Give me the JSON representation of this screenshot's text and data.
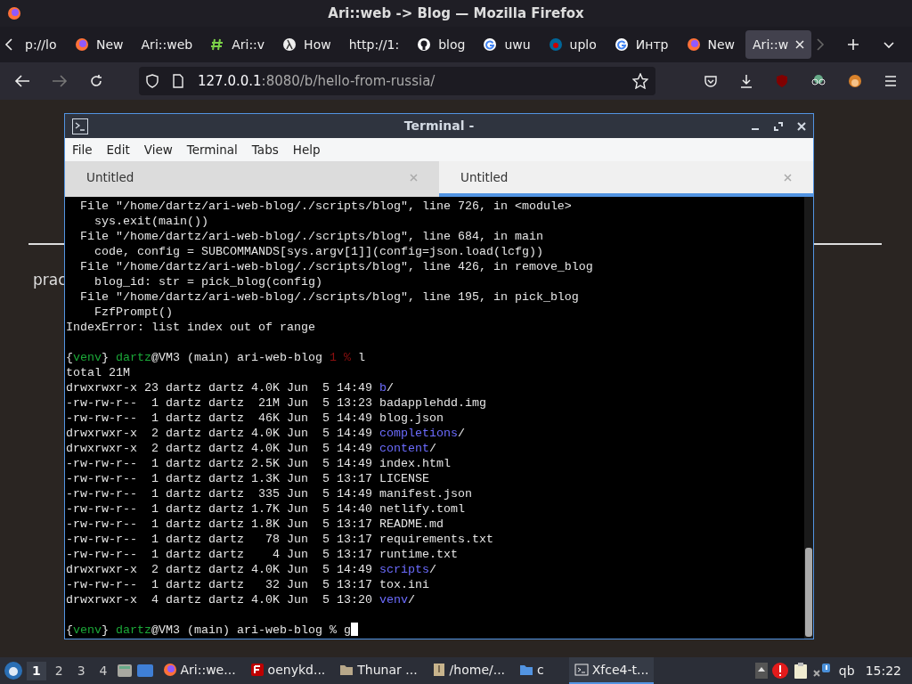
{
  "window": {
    "title": "Ari::web -> Blog — Mozilla Firefox"
  },
  "tabs": [
    {
      "label": "p://lo",
      "kind": "plain",
      "selected": false
    },
    {
      "label": "New",
      "kind": "firefox",
      "selected": false
    },
    {
      "label": "Ari::web",
      "kind": "plain",
      "selected": false
    },
    {
      "label": "Ari::v",
      "kind": "hash",
      "selected": false
    },
    {
      "label": "How",
      "kind": "lambda",
      "selected": false
    },
    {
      "label": "http://1:",
      "kind": "plain",
      "selected": false
    },
    {
      "label": "blog",
      "kind": "github",
      "selected": false
    },
    {
      "label": "uwu",
      "kind": "google",
      "selected": false
    },
    {
      "label": "uplo",
      "kind": "wiki",
      "selected": false
    },
    {
      "label": "Интр",
      "kind": "google",
      "selected": false
    },
    {
      "label": "New",
      "kind": "firefox",
      "selected": false
    },
    {
      "label": "Ari::w",
      "kind": "plain",
      "selected": true
    }
  ],
  "url": {
    "host": "127.0.0.1",
    "rest": ":8080/b/hello-from-russia/"
  },
  "page": {
    "text": "prac"
  },
  "terminal": {
    "title": "Terminal -",
    "menu": [
      "File",
      "Edit",
      "View",
      "Terminal",
      "Tabs",
      "Help"
    ],
    "tabs": [
      {
        "label": "Untitled",
        "selected": false
      },
      {
        "label": "Untitled",
        "selected": true
      }
    ],
    "blocks": [
      {
        "lines": [
          {
            "segments": [
              {
                "text": "  File \"/home/dartz/ari-web-blog/./scripts/blog\", line 726, in <module>"
              }
            ]
          },
          {
            "segments": [
              {
                "text": "    sys.exit(main())"
              }
            ]
          },
          {
            "segments": [
              {
                "text": "  File \"/home/dartz/ari-web-blog/./scripts/blog\", line 684, in main"
              }
            ]
          },
          {
            "segments": [
              {
                "text": "    code, config = SUBCOMMANDS[sys.argv[1]](config=json.load(lcfg))"
              }
            ]
          },
          {
            "segments": [
              {
                "text": "  File \"/home/dartz/ari-web-blog/./scripts/blog\", line 426, in remove_blog"
              }
            ]
          },
          {
            "segments": [
              {
                "text": "    blog_id: str = pick_blog(config)"
              }
            ]
          },
          {
            "segments": [
              {
                "text": "  File \"/home/dartz/ari-web-blog/./scripts/blog\", line 195, in pick_blog"
              }
            ]
          },
          {
            "segments": [
              {
                "text": "    FzfPrompt()"
              }
            ]
          },
          {
            "segments": [
              {
                "text": "IndexError: list index out of range"
              }
            ]
          }
        ]
      },
      {
        "lines": [
          {
            "segments": [
              {
                "text": "{"
              },
              {
                "text": "venv",
                "kind": "green"
              },
              {
                "text": "} "
              },
              {
                "text": "dartz",
                "kind": "green"
              },
              {
                "text": "@VM3 (main) ari-web-blog "
              },
              {
                "text": "1 %",
                "kind": "red"
              },
              {
                "text": " l"
              }
            ]
          },
          {
            "segments": [
              {
                "text": "total 21M"
              }
            ]
          },
          {
            "segments": [
              {
                "text": "drwxrwxr-x 23 dartz dartz 4.0K Jun  5 14:49 "
              },
              {
                "text": "b",
                "kind": "dir"
              },
              {
                "text": "/"
              }
            ]
          },
          {
            "segments": [
              {
                "text": "-rw-rw-r--  1 dartz dartz  21M Jun  5 13:23 badapplehdd.img"
              }
            ]
          },
          {
            "segments": [
              {
                "text": "-rw-rw-r--  1 dartz dartz  46K Jun  5 14:49 blog.json"
              }
            ]
          },
          {
            "segments": [
              {
                "text": "drwxrwxr-x  2 dartz dartz 4.0K Jun  5 14:49 "
              },
              {
                "text": "completions",
                "kind": "dir"
              },
              {
                "text": "/"
              }
            ]
          },
          {
            "segments": [
              {
                "text": "drwxrwxr-x  2 dartz dartz 4.0K Jun  5 14:49 "
              },
              {
                "text": "content",
                "kind": "dir"
              },
              {
                "text": "/"
              }
            ]
          },
          {
            "segments": [
              {
                "text": "-rw-rw-r--  1 dartz dartz 2.5K Jun  5 14:49 index.html"
              }
            ]
          },
          {
            "segments": [
              {
                "text": "-rw-rw-r--  1 dartz dartz 1.3K Jun  5 13:17 LICENSE"
              }
            ]
          },
          {
            "segments": [
              {
                "text": "-rw-rw-r--  1 dartz dartz  335 Jun  5 14:49 manifest.json"
              }
            ]
          },
          {
            "segments": [
              {
                "text": "-rw-rw-r--  1 dartz dartz 1.7K Jun  5 14:40 netlify.toml"
              }
            ]
          },
          {
            "segments": [
              {
                "text": "-rw-rw-r--  1 dartz dartz 1.8K Jun  5 13:17 README.md"
              }
            ]
          },
          {
            "segments": [
              {
                "text": "-rw-rw-r--  1 dartz dartz   78 Jun  5 13:17 requirements.txt"
              }
            ]
          },
          {
            "segments": [
              {
                "text": "-rw-rw-r--  1 dartz dartz    4 Jun  5 13:17 runtime.txt"
              }
            ]
          },
          {
            "segments": [
              {
                "text": "drwxrwxr-x  2 dartz dartz 4.0K Jun  5 14:49 "
              },
              {
                "text": "scripts",
                "kind": "dir"
              },
              {
                "text": "/"
              }
            ]
          },
          {
            "segments": [
              {
                "text": "-rw-rw-r--  1 dartz dartz   32 Jun  5 13:17 tox.ini"
              }
            ]
          },
          {
            "segments": [
              {
                "text": "drwxrwxr-x  4 dartz dartz 4.0K Jun  5 13:20 "
              },
              {
                "text": "venv",
                "kind": "dir"
              },
              {
                "text": "/"
              }
            ]
          }
        ]
      },
      {
        "lines": [
          {
            "segments": [
              {
                "text": "{"
              },
              {
                "text": "venv",
                "kind": "green"
              },
              {
                "text": "} "
              },
              {
                "text": "dartz",
                "kind": "green"
              },
              {
                "text": "@VM3 (main) ari-web-blog % g"
              }
            ],
            "cursor": true
          }
        ]
      }
    ]
  },
  "taskbar": {
    "workspaces": [
      {
        "label": "1",
        "selected": true
      },
      {
        "label": "2",
        "selected": false
      },
      {
        "label": "3",
        "selected": false
      },
      {
        "label": "4",
        "selected": false
      }
    ],
    "tasks": [
      {
        "label": "Ari::we...",
        "kind": "firefox",
        "selected": false
      },
      {
        "label": "oenykd...",
        "kind": "filezilla",
        "selected": false
      },
      {
        "label": "Thunar ...",
        "kind": "folder",
        "selected": false
      },
      {
        "label": "/home/...",
        "kind": "archive",
        "selected": false
      },
      {
        "label": "c",
        "kind": "folder-blue",
        "selected": false
      },
      {
        "label": "Xfce4-t...",
        "kind": "terminal",
        "selected": true
      }
    ],
    "tray_text": "qb",
    "clock": "15:22"
  }
}
